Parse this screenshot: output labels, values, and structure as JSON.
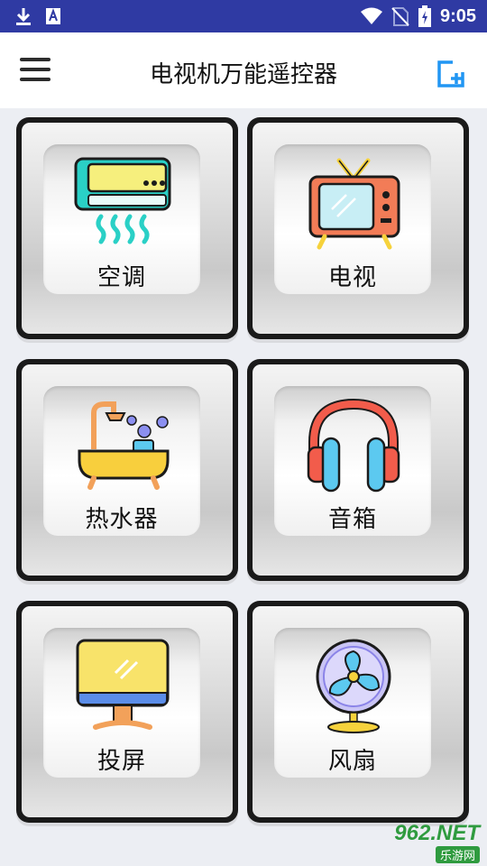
{
  "status_bar": {
    "left_icons": [
      "download-icon",
      "text-a-icon"
    ],
    "right_icons": [
      "wifi-icon",
      "no-sim-icon",
      "battery-charging-icon"
    ],
    "time": "9:05",
    "background": "#2f3aa3"
  },
  "app_bar": {
    "title": "电视机万能遥控器",
    "menu_icon": "hamburger-menu-icon",
    "add_icon": "add-device-icon",
    "accent": "#2196f3"
  },
  "devices": [
    {
      "label": "空调",
      "icon": "air-conditioner-icon"
    },
    {
      "label": "电视",
      "icon": "television-icon"
    },
    {
      "label": "热水器",
      "icon": "water-heater-bathtub-icon"
    },
    {
      "label": "音箱",
      "icon": "headphones-speaker-icon"
    },
    {
      "label": "投屏",
      "icon": "monitor-screencast-icon"
    },
    {
      "label": "风扇",
      "icon": "electric-fan-icon"
    }
  ],
  "watermark": {
    "logo": "962.NET",
    "sub": "乐游网"
  }
}
